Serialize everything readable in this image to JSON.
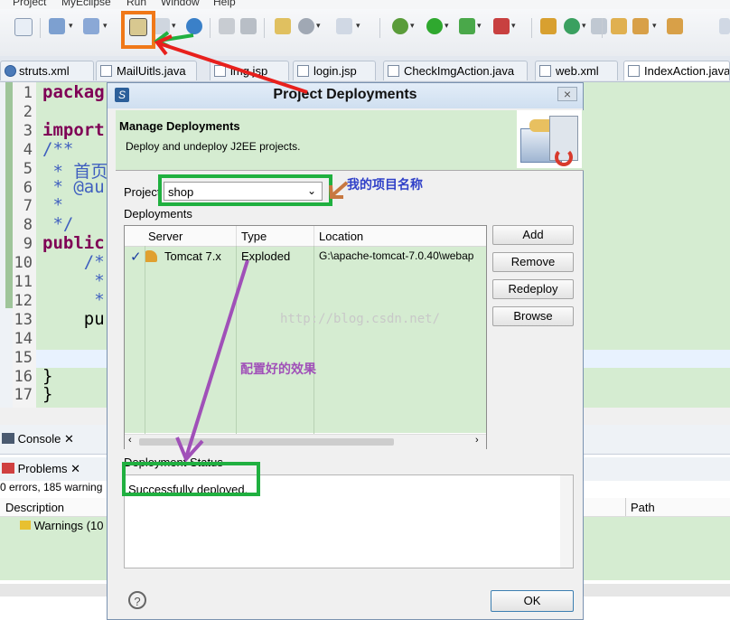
{
  "menu": {
    "items": [
      "Project",
      "MyEclipse",
      "Run",
      "Window",
      "Help"
    ]
  },
  "editor_tabs": [
    "struts.xml",
    "MailUitls.java",
    "img.jsp",
    "login.jsp",
    "CheckImgAction.java",
    "web.xml",
    "IndexAction.java"
  ],
  "code": {
    "line_numbers": [
      "1",
      "2",
      "3",
      "4",
      "5",
      "6",
      "7",
      "8",
      "9",
      "10",
      "11",
      "12",
      "13",
      "14",
      "15",
      "16",
      "17"
    ],
    "lines": [
      "packag",
      "import",
      "/**",
      " * 首页",
      " * @au",
      " *",
      " */",
      "public",
      "    /*",
      "     *",
      "     *",
      "    pu",
      "}",
      "}"
    ]
  },
  "bottom_panel": {
    "console_tab": "Console",
    "problems_tab": "Problems",
    "problems_summary": "0 errors, 185 warning",
    "col_description": "Description",
    "col_path": "Path",
    "warnings_row": "Warnings (10"
  },
  "dialog": {
    "title": "Project Deployments",
    "logo": "S",
    "close": "×",
    "banner_title": "Manage Deployments",
    "banner_subtitle": "Deploy and undeploy J2EE projects.",
    "project_label": "Project",
    "project_value": "shop",
    "deployments_label": "Deployments",
    "columns": [
      "Server",
      "Type",
      "Location"
    ],
    "row": {
      "check": "✓",
      "server": "Tomcat  7.x",
      "type": "Exploded",
      "location": "G:\\apache-tomcat-7.0.40\\webap"
    },
    "buttons": {
      "add": "Add",
      "remove": "Remove",
      "redeploy": "Redeploy",
      "browse": "Browse",
      "ok": "OK"
    },
    "status_label": "Deployment Status",
    "status_text": "Successfully deployed.",
    "help": "?"
  },
  "annotations": {
    "project_note": "我的项目名称",
    "effect_note": "配置好的效果",
    "watermark": "http://blog.csdn.net/"
  },
  "colors": {
    "highlight_green": "#d5ecd1",
    "box_green": "#20b040",
    "box_orange": "#f07818",
    "arrow_red": "#e8201c",
    "arrow_purple": "#a050b8",
    "arrow_brown": "#c87840",
    "note_blue": "#3040c8"
  }
}
